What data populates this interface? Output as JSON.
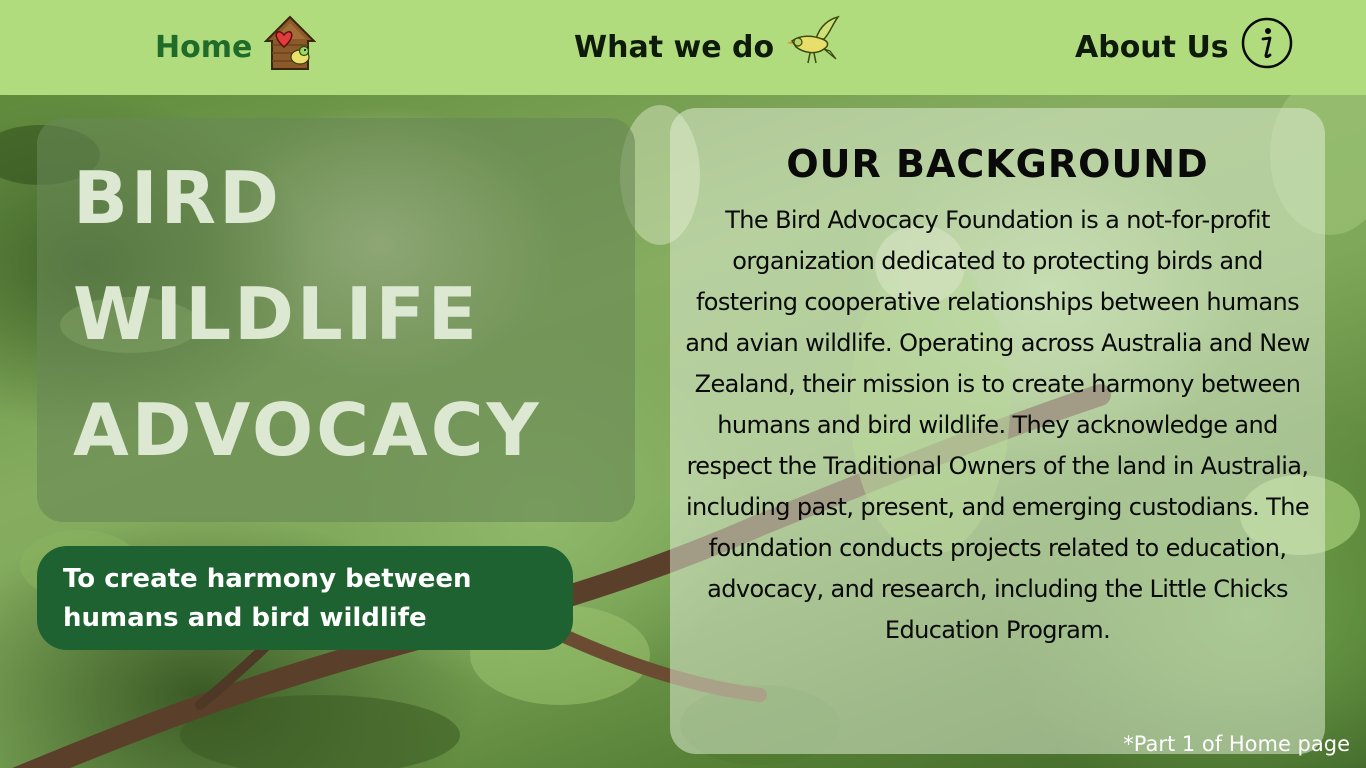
{
  "nav": {
    "home": {
      "label": "Home",
      "icon": "birdhouse-heart-icon"
    },
    "what_we_do": {
      "label": "What we do",
      "icon": "flying-bird-icon"
    },
    "about_us": {
      "label": "About Us",
      "icon": "info-circle-icon"
    }
  },
  "hero": {
    "title_lines": [
      "BIRD",
      "WILDLIFE",
      "ADVOCACY"
    ],
    "tagline": "To create harmony between humans and bird wildlife"
  },
  "background_section": {
    "heading": "OUR BACKGROUND",
    "body": "The Bird Advocacy Foundation is a not-for-profit organization dedicated to protecting birds and fostering cooperative relationships between humans and avian wildlife. Operating across Australia and New Zealand, their mission is to create harmony between humans and bird wildlife. They acknowledge and respect the Traditional Owners of the land in Australia, including past, present, and emerging custodians. The foundation conducts projects related to education, advocacy, and research, including the Little Chicks Education Program."
  },
  "footnote": "*Part 1 of Home page",
  "colors": {
    "nav_bg": "#b0dc7e",
    "home_text": "#1f6b2a",
    "tagline_bg": "#1d6230",
    "title_text": "#dde8d3"
  }
}
